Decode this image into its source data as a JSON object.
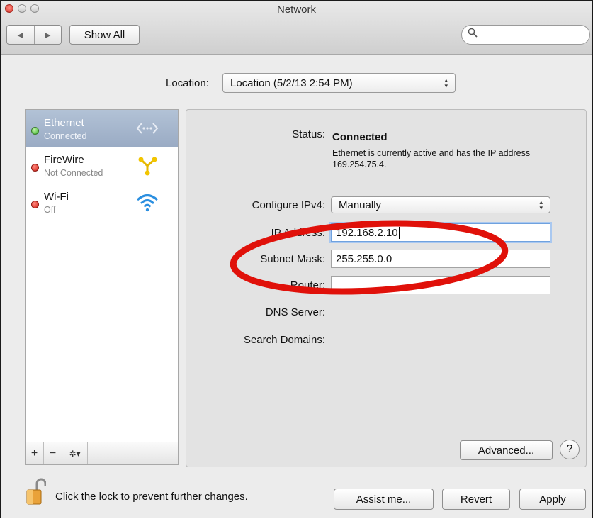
{
  "window": {
    "title": "Network"
  },
  "toolbar": {
    "back_glyph": "◀",
    "forward_glyph": "▶",
    "show_all_label": "Show All",
    "search_placeholder": "",
    "search_icon": "search-icon"
  },
  "location": {
    "label": "Location:",
    "value": "Location (5/2/13 2:54 PM)"
  },
  "services": [
    {
      "name": "Ethernet",
      "status": "Connected",
      "status_color": "green",
      "icon": "ethernet-icon",
      "selected": true
    },
    {
      "name": "FireWire",
      "status": "Not Connected",
      "status_color": "red",
      "icon": "firewire-icon",
      "selected": false
    },
    {
      "name": "Wi-Fi",
      "status": "Off",
      "status_color": "red",
      "icon": "wifi-icon",
      "selected": false
    }
  ],
  "sidebar_toolbar": {
    "add": "+",
    "remove": "−",
    "action": "✲▾"
  },
  "detail": {
    "status_label": "Status:",
    "status_value": "Connected",
    "status_description": "Ethernet is currently active and has the IP address 169.254.75.4.",
    "configure_label": "Configure IPv4:",
    "configure_value": "Manually",
    "ip_label": "IP Address:",
    "ip_value": "192.168.2.10",
    "subnet_label": "Subnet Mask:",
    "subnet_value": "255.255.0.0",
    "router_label": "Router:",
    "router_value": "",
    "dns_label": "DNS Server:",
    "search_domains_label": "Search Domains:",
    "advanced_label": "Advanced...",
    "help_label": "?"
  },
  "footer": {
    "lock_text": "Click the lock to prevent further changes.",
    "assist_label": "Assist me...",
    "revert_label": "Revert",
    "apply_label": "Apply"
  },
  "colors": {
    "selection": "#9fb0c8",
    "annotation": "#e0110a",
    "status_connected": "#2eae20",
    "status_disconnected": "#d21c12"
  }
}
